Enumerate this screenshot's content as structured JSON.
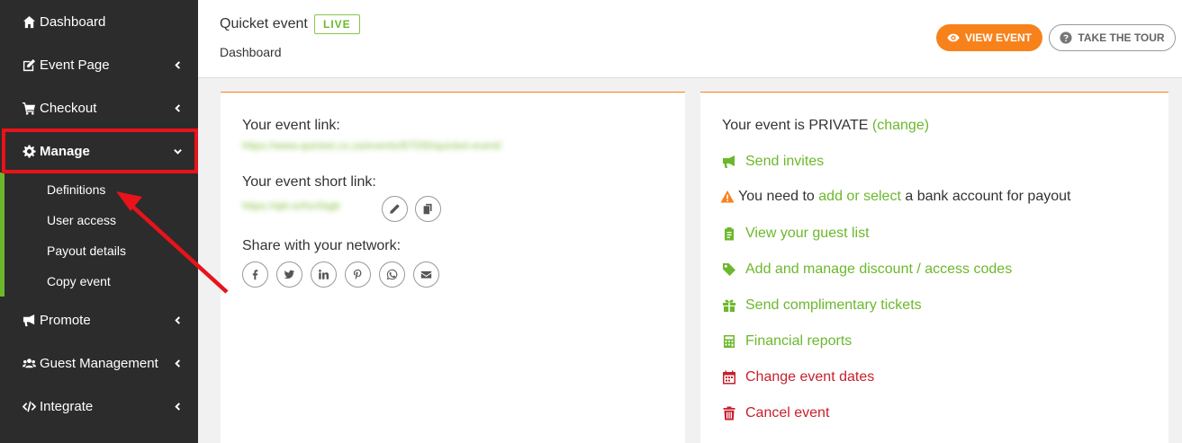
{
  "sidebar": {
    "items": [
      {
        "label": "Dashboard",
        "icon": "home-icon"
      },
      {
        "label": "Event Page",
        "icon": "edit-icon"
      },
      {
        "label": "Checkout",
        "icon": "cart-icon"
      },
      {
        "label": "Manage",
        "icon": "gear-icon"
      },
      {
        "label": "Promote",
        "icon": "megaphone-icon"
      },
      {
        "label": "Guest Management",
        "icon": "users-icon"
      },
      {
        "label": "Integrate",
        "icon": "code-icon"
      }
    ],
    "manage_submenu": [
      "Definitions",
      "User access",
      "Payout details",
      "Copy event"
    ]
  },
  "header": {
    "event_title": "Quicket event",
    "status_badge": "LIVE",
    "breadcrumb": "Dashboard",
    "view_event_label": "VIEW EVENT",
    "take_tour_label": "TAKE THE TOUR"
  },
  "links_card": {
    "event_link_label": "Your event link:",
    "event_link_value": "https://www.quicket.co.za/events/87030/quicket-event/",
    "short_link_label": "Your event short link:",
    "short_link_value": "https://qkt.io/hxXbgb",
    "share_label": "Share with your network:",
    "share_icons": [
      "facebook-icon",
      "twitter-icon",
      "linkedin-icon",
      "pinterest-icon",
      "whatsapp-icon",
      "email-icon"
    ]
  },
  "status_card": {
    "private_prefix": "Your event is PRIVATE",
    "change_link": "(change)",
    "send_invites": "Send invites",
    "warning_prefix": "You need to",
    "warning_link": "add or select",
    "warning_suffix": "a bank account for payout",
    "guest_list": "View your guest list",
    "discount_codes": "Add and manage discount / access codes",
    "complimentary": "Send complimentary tickets",
    "financial": "Financial reports",
    "change_dates": "Change event dates",
    "cancel": "Cancel event"
  },
  "colors": {
    "sidebar_bg": "#2c2c2c",
    "accent_green": "#6cb82c",
    "accent_orange": "#f7821b",
    "danger_red": "#c8202c",
    "highlight_red": "#e8131b"
  }
}
